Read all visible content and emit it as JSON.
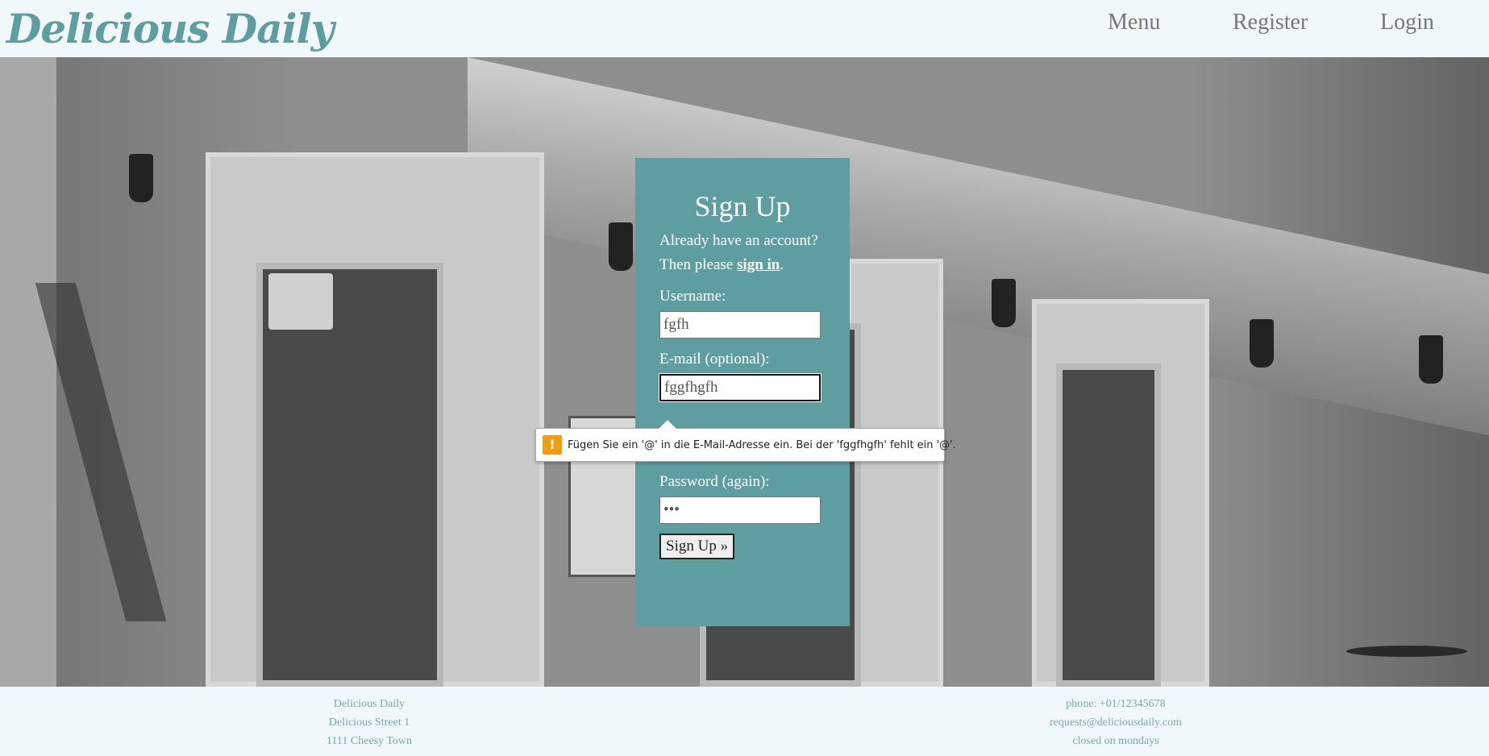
{
  "header": {
    "logo": "Delicious Daily",
    "nav": [
      {
        "label": "Menu"
      },
      {
        "label": "Register"
      },
      {
        "label": "Login"
      }
    ]
  },
  "signup": {
    "title": "Sign Up",
    "already": "Already have an account?",
    "then_please": "Then please ",
    "sign_in_link": "sign in",
    "period": ".",
    "username_label": "Username:",
    "username_value": "fgfh",
    "email_label": "E-mail (optional):",
    "email_value": "fggfhgfh",
    "password_value": "••••••",
    "password_again_label": "Password (again):",
    "password_again_value": "•••",
    "submit_label": "Sign Up »"
  },
  "tooltip": {
    "icon": "!",
    "message": "Fügen Sie ein '@' in die E-Mail-Adresse ein. Bei der 'fggfhgfh' fehlt ein '@'."
  },
  "footer": {
    "left": [
      "Delicious Daily",
      "Delicious Street 1",
      "1111 Cheesy Town"
    ],
    "right": [
      "phone: +01/12345678",
      "requests@deliciousdaily.com",
      "closed on mondays"
    ]
  },
  "colors": {
    "brand": "#5f9ea0",
    "background": "#f0f8fc",
    "warning": "#f39c12"
  }
}
